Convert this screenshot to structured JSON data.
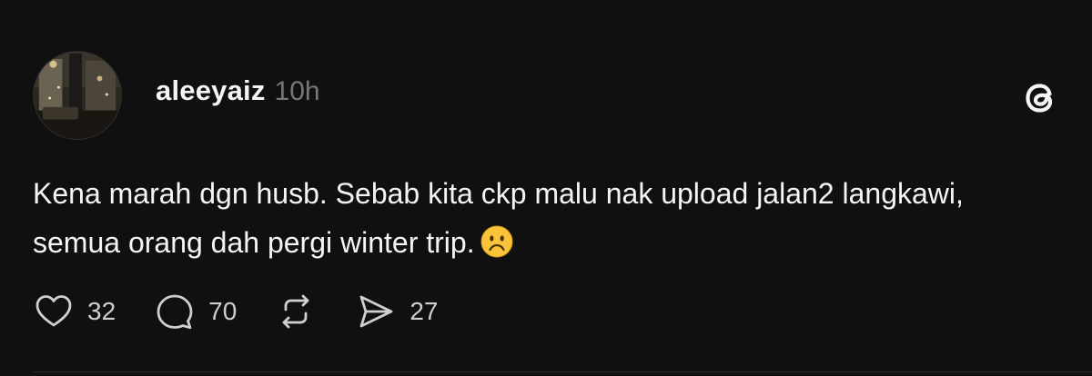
{
  "post": {
    "author": "aleeyaiz",
    "time_ago": "10h",
    "text": "Kena marah dgn husb. Sebab kita ckp malu nak upload jalan2 langkawi, semua orang dah pergi winter trip.",
    "emoji": "frowning-face"
  },
  "actions": {
    "likes": "32",
    "replies": "70",
    "shares": "27"
  },
  "colors": {
    "background": "#101010",
    "text": "#f3f5f7",
    "muted": "#777777"
  }
}
